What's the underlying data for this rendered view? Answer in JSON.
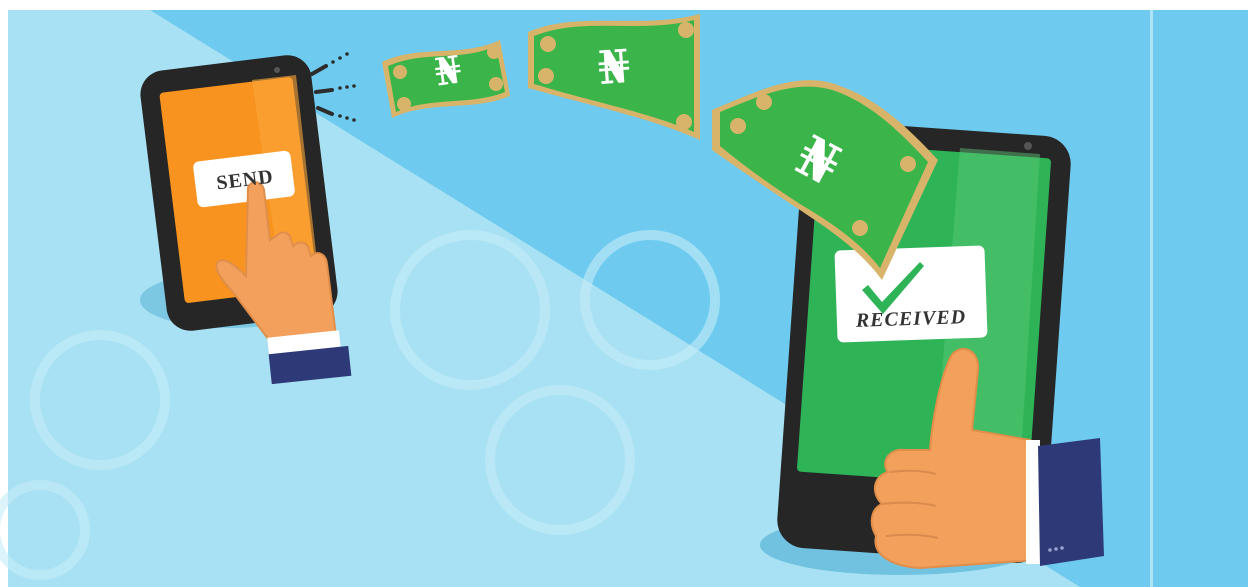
{
  "illustration": {
    "sender_phone": {
      "button_label": "SEND"
    },
    "receiver_phone": {
      "badge_label": "RECEIVED",
      "check_icon": "checkmark-icon"
    },
    "banknotes": {
      "currency_symbol": "₦",
      "count": 3
    },
    "colors": {
      "sky_light": "#a7e1f3",
      "sky_dark": "#69c8ee",
      "sender_screen": "#f7931e",
      "receiver_screen": "#2eb457",
      "note_green": "#3bb54a",
      "note_border": "#d7b46a",
      "skin": "#f2a05c",
      "sleeve": "#2e3a78"
    }
  }
}
